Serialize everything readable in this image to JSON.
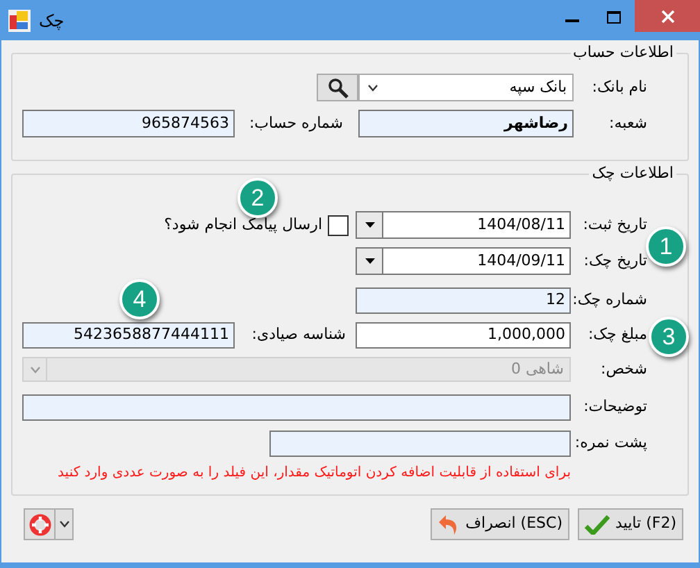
{
  "window": {
    "title": "چک"
  },
  "account_group": {
    "title": "اطلاعات حساب",
    "bank": {
      "label": "نام بانک:",
      "value": "بانک سپه"
    },
    "branch": {
      "label": "شعبه:",
      "value": "رضاشهر"
    },
    "account_number": {
      "label": "شماره حساب:",
      "value": "965874563"
    }
  },
  "check_group": {
    "title": "اطلاعات چک",
    "register_date": {
      "label": "تاریخ ثبت:",
      "value": "1404/08/11"
    },
    "sms": {
      "label": "ارسال پیامک انجام شود؟",
      "checked": false
    },
    "check_date": {
      "label": "تاریخ چک:",
      "value": "1404/09/11"
    },
    "check_number": {
      "label": "شماره چک:",
      "value": "12"
    },
    "amount": {
      "label": "مبلغ چک:",
      "value": "1,000,000"
    },
    "sayad_id": {
      "label": "شناسه صیادی:",
      "value": "5423658877444111"
    },
    "person": {
      "label": "شخص:",
      "value": "شاهی 0",
      "disabled": true
    },
    "description": {
      "label": "توضیحات:"
    },
    "back_number": {
      "label": "پشت نمره:"
    },
    "hint": "برای استفاده از قابلیت اضافه کردن اتوماتیک مقدار، این فیلد را به صورت عددی وارد کنید"
  },
  "buttons": [
    {
      "kind": "confirm",
      "label": "تایید (F2)"
    },
    {
      "kind": "cancel",
      "label": "انصراف (ESC)"
    }
  ],
  "callouts": [
    "1",
    "2",
    "3",
    "4"
  ]
}
